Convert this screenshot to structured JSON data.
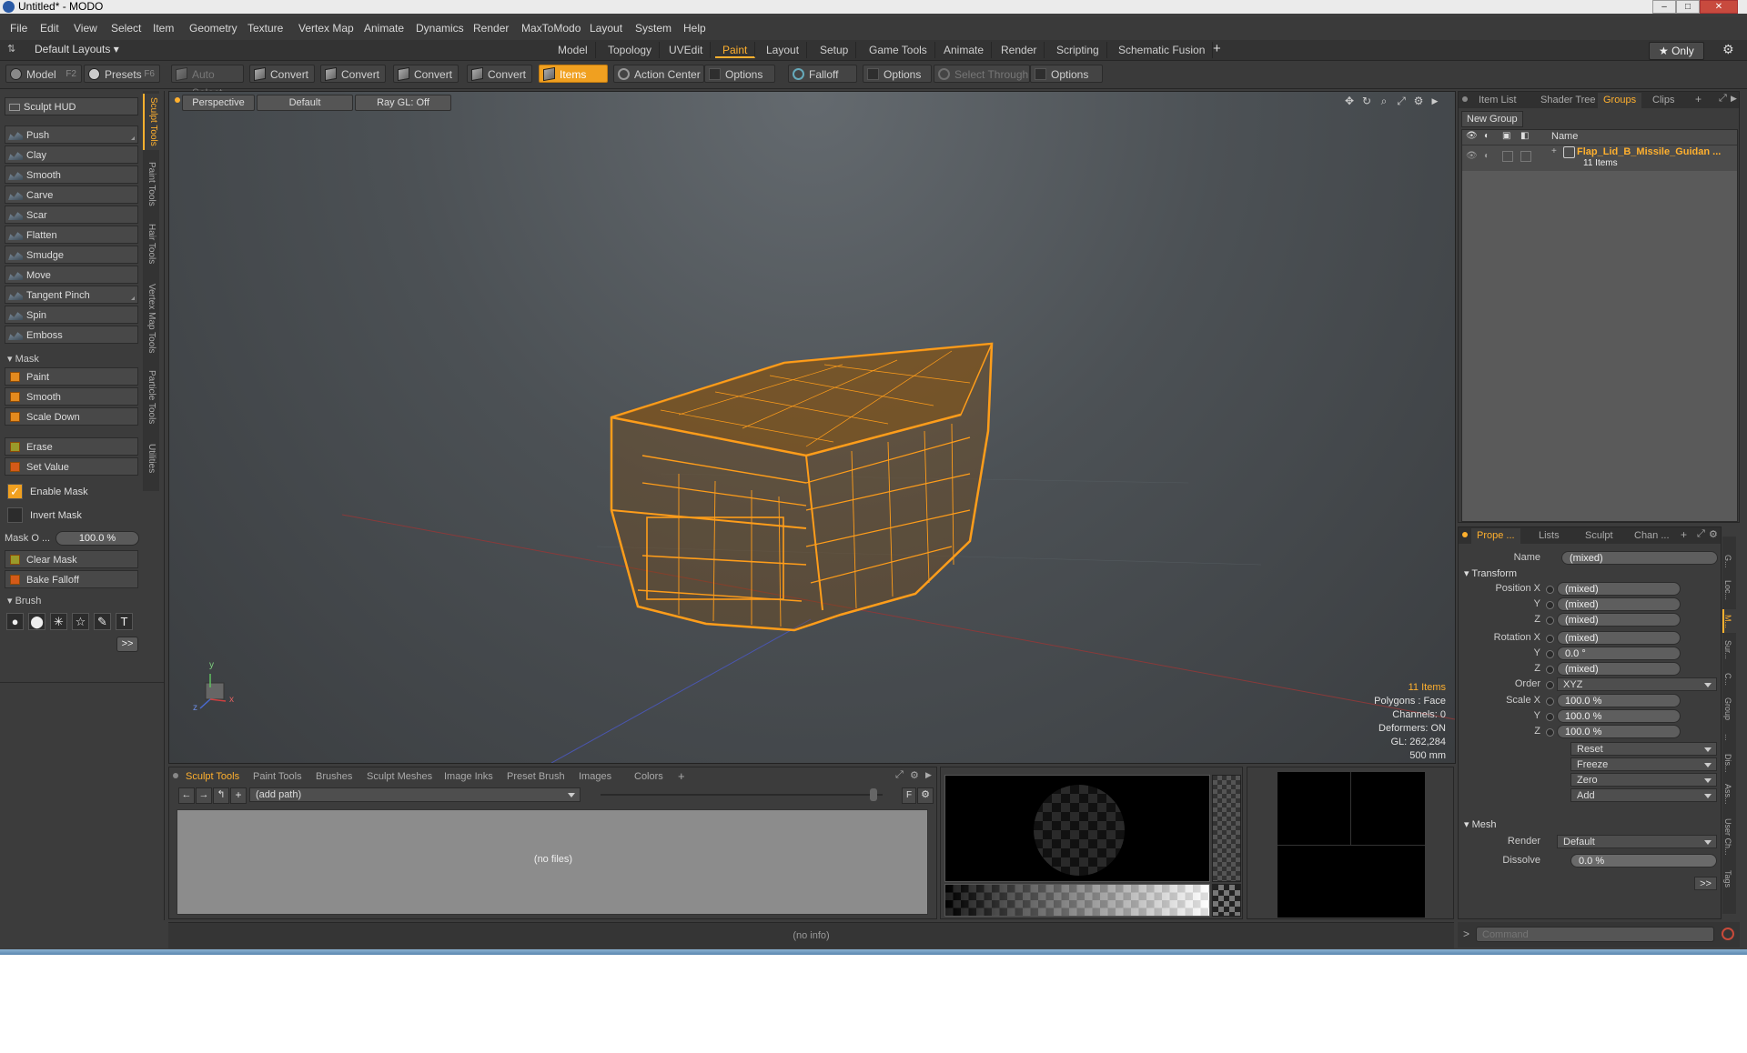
{
  "window": {
    "title": "Untitled* - MODO",
    "min": "–",
    "max": "□",
    "close": "✕"
  },
  "menu": [
    "File",
    "Edit",
    "View",
    "Select",
    "Item",
    "Geometry",
    "Texture",
    "Vertex Map",
    "Animate",
    "Dynamics",
    "Render",
    "MaxToModo",
    "Layout",
    "System",
    "Help"
  ],
  "layouts": {
    "label": "Default Layouts ▾",
    "tabs": [
      "Model",
      "Topology",
      "UVEdit",
      "Paint",
      "Layout",
      "Setup",
      "Game Tools",
      "Animate",
      "Render",
      "Scripting",
      "Schematic Fusion"
    ],
    "active": "Paint",
    "add": "+",
    "only": "★  Only",
    "gear": "⚙"
  },
  "toolbar": {
    "model": "Model",
    "model_key": "F2",
    "presets": "Presets",
    "presets_key": "F6",
    "auto_select": "Auto Select",
    "convert1": "Convert",
    "convert2": "Convert",
    "convert3": "Convert",
    "convert4": "Convert",
    "items": "Items",
    "action_center": "Action Center",
    "options1": "Options",
    "falloff": "Falloff",
    "options2": "Options",
    "select_through": "Select Through",
    "options3": "Options"
  },
  "sculpt": {
    "hud": "Sculpt HUD",
    "tools": [
      "Push",
      "Clay",
      "Smooth",
      "Carve",
      "Scar",
      "Flatten",
      "Smudge",
      "Move",
      "Tangent Pinch",
      "Spin",
      "Emboss"
    ],
    "mask_header": "Mask",
    "mask_tools": [
      "Paint",
      "Smooth",
      "Scale Down"
    ],
    "erase": "Erase",
    "set_value": "Set Value",
    "enable_mask": "Enable Mask",
    "invert_mask": "Invert Mask",
    "mask_opacity_label": "Mask O ...",
    "mask_opacity_value": "100.0 %",
    "clear_mask": "Clear Mask",
    "bake_falloff": "Bake Falloff",
    "brush_header": "Brush",
    "more": ">>",
    "side_tabs": [
      "Sculpt Tools",
      "Paint Tools",
      "Hair Tools",
      "Vertex Map Tools",
      "Particle Tools",
      "Utilities"
    ]
  },
  "viewport": {
    "view": "Perspective",
    "shading": "Default",
    "raygl": "Ray GL: Off",
    "stats": {
      "items": "11 Items",
      "polygons": "Polygons : Face",
      "channels": "Channels: 0",
      "deformers": "Deformers: ON",
      "gl": "GL: 262,284",
      "scale": "500 mm"
    },
    "axis_y": "y",
    "axis_x": "x",
    "axis_z": "z"
  },
  "groups_panel": {
    "tabs": [
      "Item List",
      "Shader Tree",
      "Groups",
      "Clips"
    ],
    "active": "Groups",
    "new_group": "New Group",
    "name_col": "Name",
    "item_name": "Flap_Lid_B_Missile_Guidan ...",
    "item_count": "11 Items"
  },
  "properties": {
    "tabs": [
      "Prope ...",
      "Lists",
      "Sculpt",
      "Chan ..."
    ],
    "name_label": "Name",
    "name_value": "(mixed)",
    "transform_header": "Transform",
    "position_label": "Position X",
    "pos": [
      "(mixed)",
      "(mixed)",
      "(mixed)"
    ],
    "rotation_label": "Rotation X",
    "rot": [
      "(mixed)",
      "0.0 °",
      "(mixed)"
    ],
    "order_label": "Order",
    "order_value": "XYZ",
    "scale_label": "Scale X",
    "scale": [
      "100.0 %",
      "100.0 %",
      "100.0 %"
    ],
    "y_label": "Y",
    "z_label": "Z",
    "actions": [
      "Reset",
      "Freeze",
      "Zero",
      "Add"
    ],
    "mesh_header": "Mesh",
    "render_label": "Render",
    "render_value": "Default",
    "dissolve_label": "Dissolve",
    "dissolve_value": "0.0 %",
    "more": ">>",
    "side_tabs": [
      "G...",
      "Loc...",
      "M...",
      "Sur...",
      "C...",
      "Group",
      "...",
      "Dis...",
      "Ass...",
      "User Ch...",
      "Tags"
    ]
  },
  "bottom": {
    "tabs": [
      "Sculpt Tools",
      "Paint Tools",
      "Brushes",
      "Sculpt Meshes",
      "Image Inks",
      "Preset Brush",
      "Images",
      "Colors"
    ],
    "active": "Sculpt Tools",
    "add": "+",
    "path": "(add path)",
    "no_files": "(no files)",
    "f_btn": "F"
  },
  "status": {
    "info": "(no info)",
    "command_prompt": ">",
    "command_placeholder": "Command"
  },
  "colors": {
    "accent": "#ffb02e",
    "wire": "#ff9d1a",
    "items": "#f0a020"
  }
}
